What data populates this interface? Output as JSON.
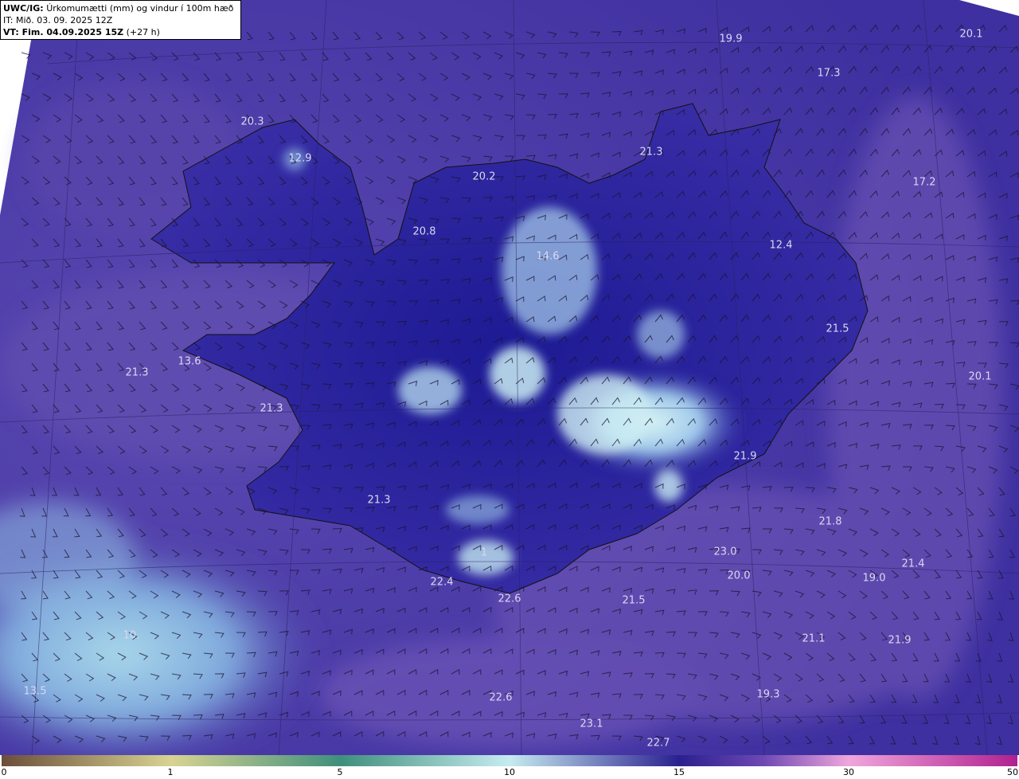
{
  "header": {
    "model_label": "UWC/IG:",
    "title": "Úrkomumætti (mm) og vindur í 100m hæð",
    "it_line": "IT: Mið. 03. 09. 2025 12Z",
    "vt_label": "VT: Fim. 04.09.2025 15Z",
    "vt_offset": "(+27 h)"
  },
  "map_values": [
    "19.9",
    "20.1",
    "17.3",
    "20.3",
    "12.9",
    "21.3",
    "17.2",
    "20.2",
    "20.8",
    "14.6",
    "12.4",
    "21.5",
    "13.6",
    "21.3",
    "20.1",
    "21.3",
    "21.9",
    "21.3",
    "21.8",
    "23.0",
    "1",
    "21.4",
    "20.0",
    "19.0",
    "22.4",
    "22.6",
    "21.5",
    "10.",
    "21.1",
    "21.9",
    "13.5",
    "19.3",
    "22.6",
    "23.1",
    "22.7"
  ],
  "colorbar": {
    "ticks": [
      "0",
      "1",
      "5",
      "10",
      "15",
      "30",
      "50"
    ],
    "colors": {
      "c0": "#6b4e3a",
      "c1": "#d8d391",
      "c2": "#3f8f7c",
      "c3": "#c6ecf0",
      "c4": "#2a208f",
      "c5": "#6e48b2",
      "c6": "#f0a6dc",
      "c7": "#b0208f"
    }
  },
  "colors": {
    "sea_background": "#4b3ca6",
    "land_core": "#1e1b96",
    "snow_highlight": "#c8e8f0",
    "label_text": "#d8d8ee",
    "coastline": "#111111"
  }
}
